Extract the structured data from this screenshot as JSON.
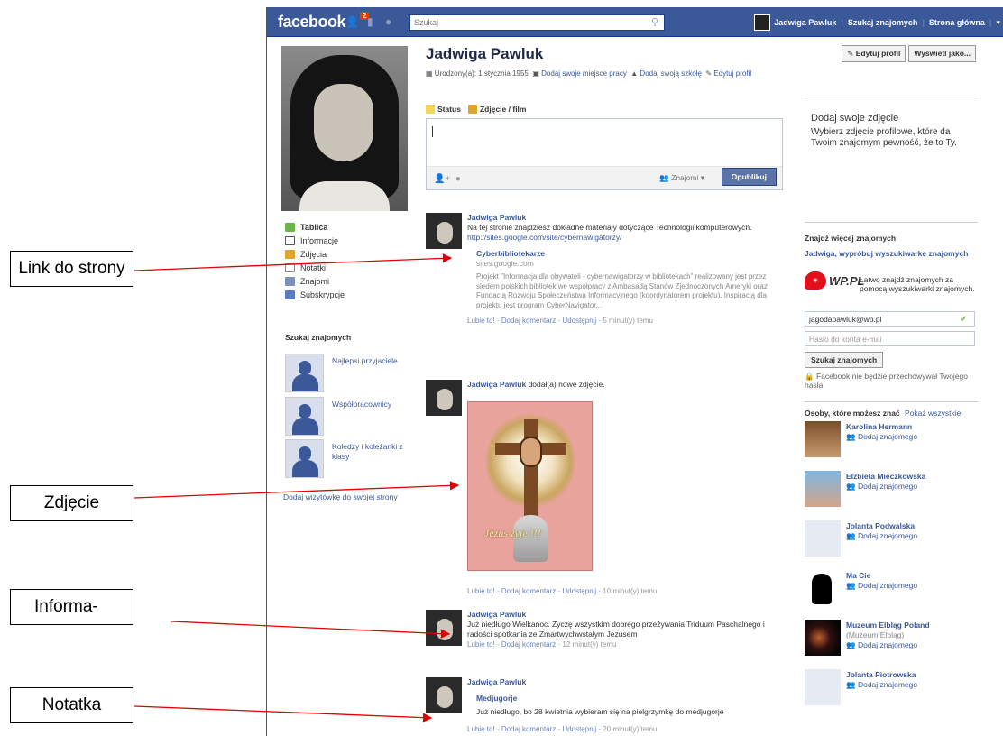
{
  "topbar": {
    "logo": "facebook",
    "notification_count": "2",
    "search_placeholder": "Szukaj",
    "user_name": "Jadwiga Pawluk",
    "find_friends": "Szukaj znajomych",
    "home": "Strona główna"
  },
  "profile": {
    "name": "Jadwiga Pawluk",
    "born_label": "Urodzony(a): 1 stycznia 1955",
    "add_work": "Dodaj swoje miejsce pracy",
    "add_school": "Dodaj swoją szkołę",
    "edit_profile_link": "Edytuj profil",
    "edit_profile_btn": "Edytuj profil",
    "view_as_btn": "Wyświetl jako..."
  },
  "leftnav": {
    "items": [
      "Tablica",
      "Informacje",
      "Zdjęcia",
      "Notatki",
      "Znajomi",
      "Subskrypcje"
    ],
    "friends_title": "Szukaj znajomych",
    "friend_lists": [
      "Najlepsi przyjaciele",
      "Współpracownicy",
      "Koledzy i koleżanki z klasy"
    ],
    "card_link": "Dodaj wizytówkę do swojej strony"
  },
  "composer": {
    "tab_status": "Status",
    "tab_photo": "Zdjęcie / film",
    "audience": "Znajomi",
    "publish": "Opublikuj"
  },
  "posts": [
    {
      "author": "Jadwiga Pawluk",
      "text": "Na tej stronie znajdziesz dokładne materiały dotyczące Technologii komputerowych.",
      "url": "http://sites.google.com/site/cybernawigatorzy/",
      "attach_title": "Cyberbibliotekarze",
      "attach_source": "sites.google.com",
      "attach_desc": "Projekt \"Informacja dla obywateli - cybernawigatorzy w bibliotekach\" realizowany jest przez siedem polskich bibliotek we współpracy z Ambasadą Stanów Zjednoczonych Ameryki oraz Fundacją Rozwoju Społeczeństwa Informacyjnego (koordynatorem projektu). Inspiracją dla projektu jest program CyberNavigator...",
      "like": "Lubię to!",
      "comment": "Dodaj komentarz",
      "share": "Udostępnij",
      "time": "5 minut(y) temu"
    },
    {
      "author": "Jadwiga Pawluk",
      "text": "dodał(a) nowe zdjęcie.",
      "photo_caption": "Jezus żyje !!!",
      "like": "Lubię to!",
      "comment": "Dodaj komentarz",
      "share": "Udostępnij",
      "time": "10 minut(y) temu"
    },
    {
      "author": "Jadwiga Pawluk",
      "text": "Już niedługo Wielkanoc. Życzę wszystkim dobrego przeżywania Triduum Paschalnego i radości spotkania ze Zmartwychwstałym Jezusem",
      "like": "Lubię to!",
      "comment": "Dodaj komentarz",
      "time": "12 minut(y) temu"
    },
    {
      "author": "Jadwiga Pawluk",
      "note_title": "Medjugorje",
      "note_text": "Już niedługo, bo 28 kwietnia wybieram się na pielgrzymkę do medjugorje",
      "like": "Lubię to!",
      "comment": "Dodaj komentarz",
      "share": "Udostępnij",
      "time": "20 minut(y) temu"
    }
  ],
  "right": {
    "addphoto_title": "Dodaj swoje zdjęcie",
    "addphoto_desc": "Wybierz zdjęcie profilowe, które da Twoim znajomym pewność, że to Ty.",
    "findmore_title": "Znajdź więcej znajomych",
    "findmore_sub": "Jadwiga, wypróbuj wyszukiwarkę znajomych",
    "wp_logo": "WP.PL",
    "wp_desc": "Łatwo znajdź znajomych za pomocą wyszukiwarki znajomych.",
    "email_value": "jagodapawluk@wp.pl",
    "password_placeholder": "Hasło do konta e-mai",
    "find_btn": "Szukaj znajomych",
    "privacy": "Facebook nie będzie przechowywał Twojego hasła",
    "pymk_title": "Osoby, które możesz znać",
    "pymk_all": "Pokaż wszystkie",
    "add_friend": "Dodaj znajomego",
    "people": [
      {
        "name": "Karolina Hermann",
        "sub": ""
      },
      {
        "name": "Elżbieta Mieczkowska",
        "sub": ""
      },
      {
        "name": "Jolanta Podwalska",
        "sub": ""
      },
      {
        "name": "Ma Cie",
        "sub": ""
      },
      {
        "name": "Muzeum Elbląg Poland",
        "sub": "(Muzeum Elbląg)"
      },
      {
        "name": "Jolanta Piotrowska",
        "sub": ""
      }
    ]
  },
  "callouts": [
    "Link do strony",
    "Zdjęcie",
    "Informa-",
    "Notatka"
  ],
  "colors": {
    "facebook_blue": "#3b5998",
    "arrow_red": "#e00000",
    "badge_red": "#dd3c10"
  }
}
